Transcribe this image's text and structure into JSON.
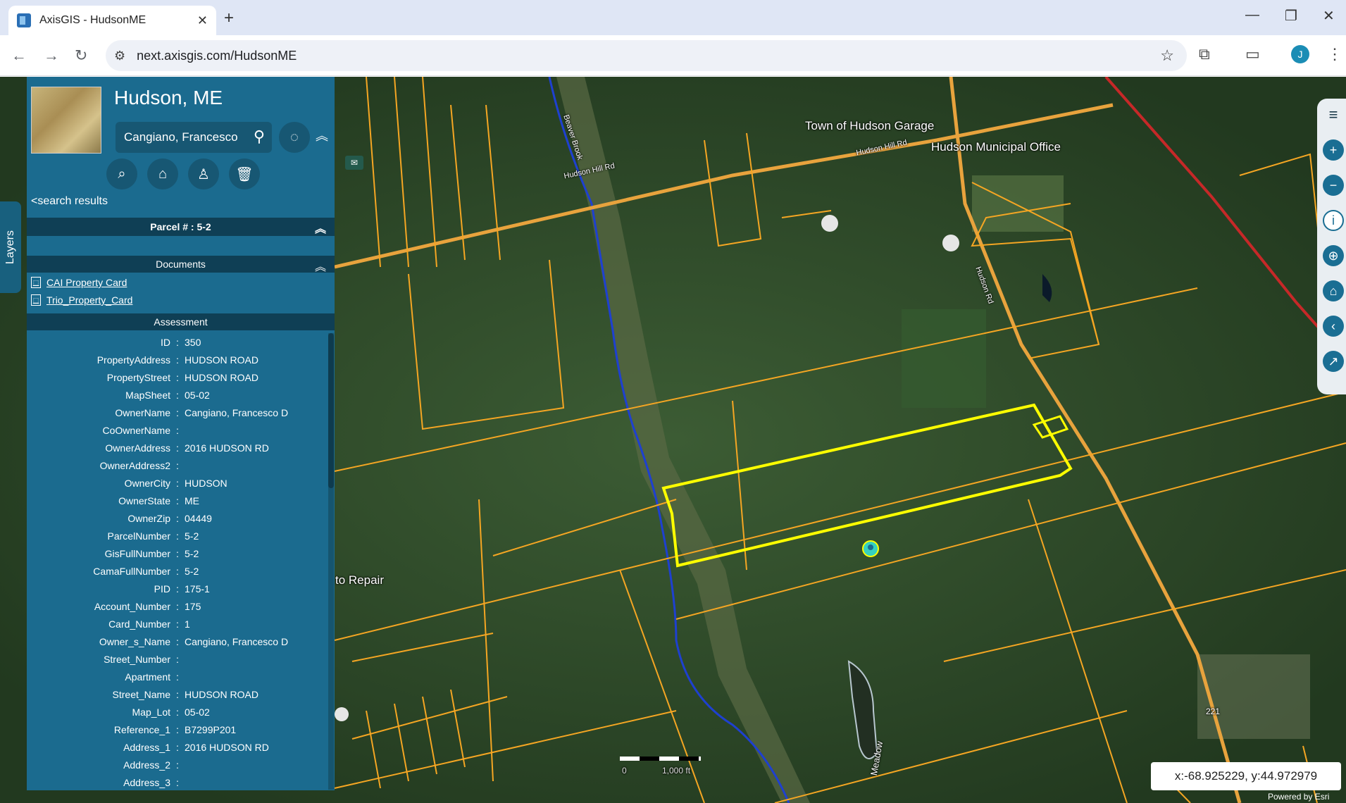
{
  "browser": {
    "tab_title": "AxisGIS - HudsonME",
    "new_tab": "+",
    "url": "next.axisgis.com/HudsonME",
    "profile_initial": "J"
  },
  "panel": {
    "town": "Hudson, ME",
    "owner_filter": "Cangiano, Francesco",
    "back_link": "<search results",
    "parcel_header": "Parcel # : 5-2",
    "documents_header": "Documents",
    "documents": [
      "CAI Property Card",
      "Trio_Property_Card"
    ],
    "assessment_header": "Assessment",
    "rows": [
      {
        "k": "ID",
        "v": "350"
      },
      {
        "k": "PropertyAddress",
        "v": "HUDSON ROAD"
      },
      {
        "k": "PropertyStreet",
        "v": "HUDSON ROAD"
      },
      {
        "k": "MapSheet",
        "v": "05-02"
      },
      {
        "k": "OwnerName",
        "v": "Cangiano, Francesco D"
      },
      {
        "k": "CoOwnerName",
        "v": ""
      },
      {
        "k": "OwnerAddress",
        "v": "2016 HUDSON RD"
      },
      {
        "k": "OwnerAddress2",
        "v": ""
      },
      {
        "k": "OwnerCity",
        "v": "HUDSON"
      },
      {
        "k": "OwnerState",
        "v": "ME"
      },
      {
        "k": "OwnerZip",
        "v": "04449"
      },
      {
        "k": "ParcelNumber",
        "v": "5-2"
      },
      {
        "k": "GisFullNumber",
        "v": "5-2"
      },
      {
        "k": "CamaFullNumber",
        "v": "5-2"
      },
      {
        "k": "PID",
        "v": "175-1"
      },
      {
        "k": "Account_Number",
        "v": "175"
      },
      {
        "k": "Card_Number",
        "v": "1"
      },
      {
        "k": "Owner_s_Name",
        "v": "Cangiano, Francesco D"
      },
      {
        "k": "Street_Number",
        "v": ""
      },
      {
        "k": "Apartment",
        "v": ""
      },
      {
        "k": "Street_Name",
        "v": "HUDSON ROAD"
      },
      {
        "k": "Map_Lot",
        "v": "05-02"
      },
      {
        "k": "Reference_1",
        "v": "B7299P201"
      },
      {
        "k": "Address_1",
        "v": "2016 HUDSON RD"
      },
      {
        "k": "Address_2",
        "v": ""
      },
      {
        "k": "Address_3",
        "v": ""
      }
    ]
  },
  "side_tab": "Layers",
  "map": {
    "labels": {
      "garage": "Town of Hudson Garage",
      "office": "Hudson Municipal Office",
      "hill_rd_1": "Hudson Hill Rd",
      "hill_rd_2": "Hudson Hill Rd",
      "hudson_rd": "Hudson Rd",
      "stream": "Beaver Brook",
      "repair": "to Repair",
      "meadow": "Meadow",
      "route": "221"
    },
    "scale": {
      "zero": "0",
      "dist": "1,000 ft"
    },
    "coords": "x:-68.925229, y:44.972979",
    "attribution": "Powered by Esri"
  },
  "colors": {
    "panel": "#1b6b8f",
    "parcel_line": "#f5a623",
    "selected": "#ffff00",
    "stream": "#1e40d0"
  }
}
